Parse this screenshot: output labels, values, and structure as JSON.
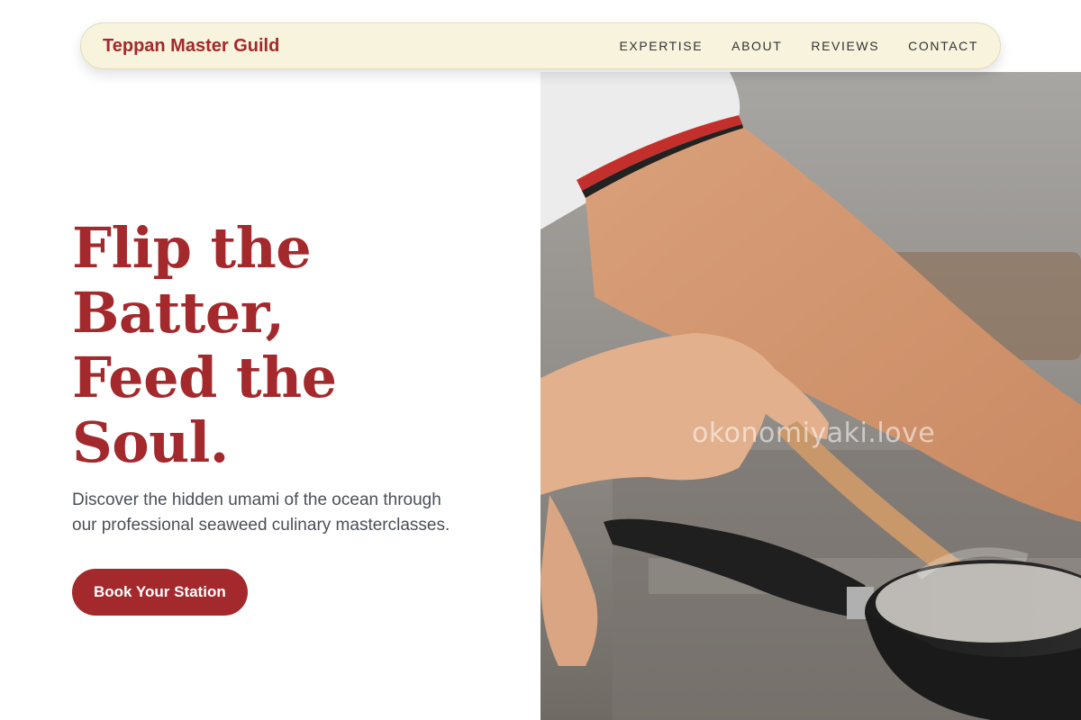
{
  "nav": {
    "brand": "Teppan Master Guild",
    "links": [
      "EXPERTISE",
      "ABOUT",
      "REVIEWS",
      "CONTACT"
    ]
  },
  "hero": {
    "headline_lines": [
      "Flip the",
      "Batter,",
      "Feed the",
      "Soul."
    ],
    "subtitle": "Discover the hidden umami of the ocean through our professional seaweed culinary masterclasses.",
    "cta_label": "Book Your Station"
  },
  "photo": {
    "watermark": "okonomiyaki.love",
    "icon": "cooking-photo"
  },
  "colors": {
    "brand": "#a3292c",
    "nav_bg": "#f7f3dc",
    "text_muted": "#4a4f57"
  }
}
